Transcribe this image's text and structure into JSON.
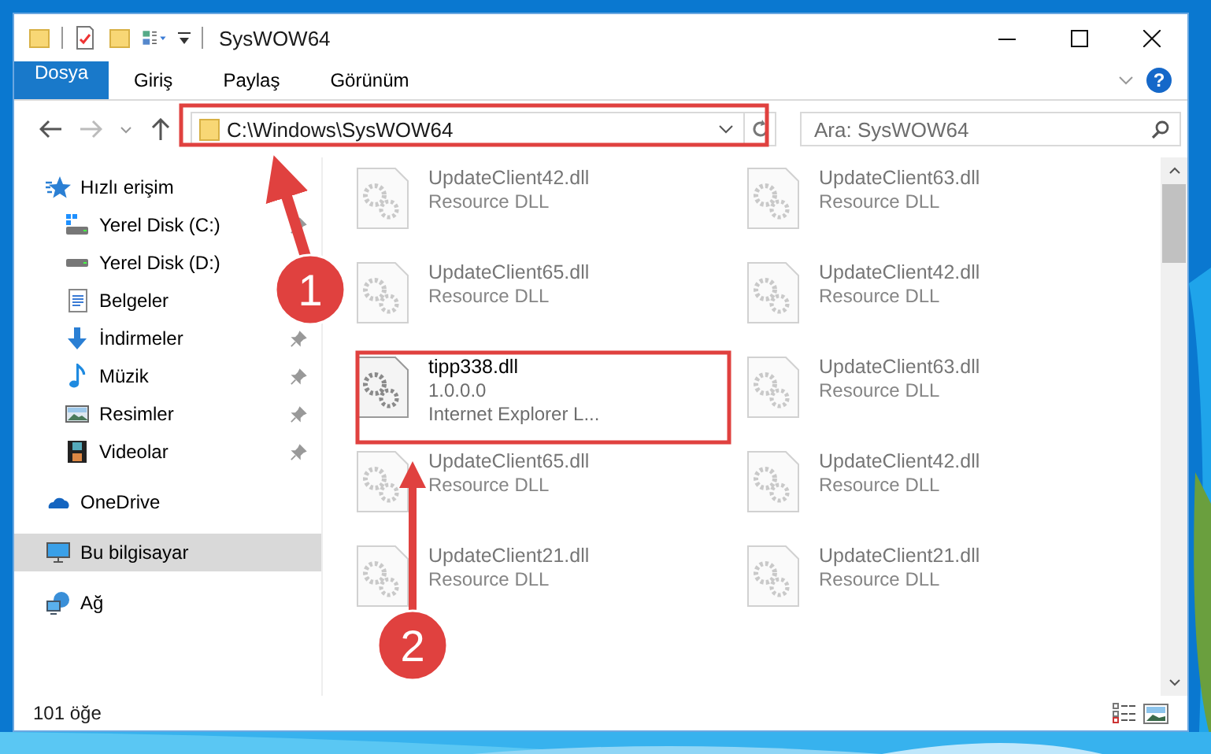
{
  "window": {
    "title": "SysWOW64"
  },
  "ribbon_tabs": [
    {
      "label": "Dosya",
      "kind": "file"
    },
    {
      "label": "Giriş",
      "kind": "tab"
    },
    {
      "label": "Paylaş",
      "kind": "tab"
    },
    {
      "label": "Görünüm",
      "kind": "tab"
    }
  ],
  "help_label": "?",
  "address": {
    "path": "C:\\Windows\\SysWOW64"
  },
  "search": {
    "placeholder": "Ara: SysWOW64"
  },
  "navigation": [
    {
      "label": "Hızlı erişim",
      "kind": "star",
      "selected": false,
      "children": [
        {
          "label": "Yerel Disk (C:)",
          "kind": "system-drive",
          "pinned": true
        },
        {
          "label": "Yerel Disk (D:)",
          "kind": "drive",
          "pinned": false
        },
        {
          "label": "Belgeler",
          "kind": "document",
          "pinned": false
        },
        {
          "label": "İndirmeler",
          "kind": "download",
          "pinned": true
        },
        {
          "label": "Müzik",
          "kind": "music",
          "pinned": true
        },
        {
          "label": "Resimler",
          "kind": "pictures",
          "pinned": true
        },
        {
          "label": "Videolar",
          "kind": "video",
          "pinned": true
        }
      ]
    },
    {
      "label": "OneDrive",
      "kind": "cloud",
      "selected": false
    },
    {
      "label": "Bu bilgisayar",
      "kind": "computer",
      "selected": true
    },
    {
      "label": "Ağ",
      "kind": "network",
      "selected": false
    }
  ],
  "files": [
    {
      "name": "UpdateClient42.dll",
      "lines": [
        "Resource DLL"
      ],
      "blurred": true
    },
    {
      "name": "UpdateClient63.dll",
      "lines": [
        "Resource DLL"
      ],
      "blurred": true
    },
    {
      "name": "UpdateClient65.dll",
      "lines": [
        "Resource DLL"
      ],
      "blurred": true
    },
    {
      "name": "UpdateClient42.dll",
      "lines": [
        "Resource DLL"
      ],
      "blurred": true
    },
    {
      "name": "tipp338.dll",
      "lines": [
        "1.0.0.0",
        "Internet Explorer L..."
      ],
      "blurred": false
    },
    {
      "name": "UpdateClient63.dll",
      "lines": [
        "Resource DLL"
      ],
      "blurred": true
    },
    {
      "name": "UpdateClient65.dll",
      "lines": [
        "Resource DLL"
      ],
      "blurred": true
    },
    {
      "name": "UpdateClient42.dll",
      "lines": [
        "Resource DLL"
      ],
      "blurred": true
    },
    {
      "name": "UpdateClient21.dll",
      "lines": [
        "Resource DLL"
      ],
      "blurred": true
    },
    {
      "name": "UpdateClient21.dll",
      "lines": [
        "Resource DLL"
      ],
      "blurred": true
    }
  ],
  "status_bar": {
    "item_count": "101 öğe"
  },
  "annotations": [
    {
      "number": "1"
    },
    {
      "number": "2"
    }
  ]
}
